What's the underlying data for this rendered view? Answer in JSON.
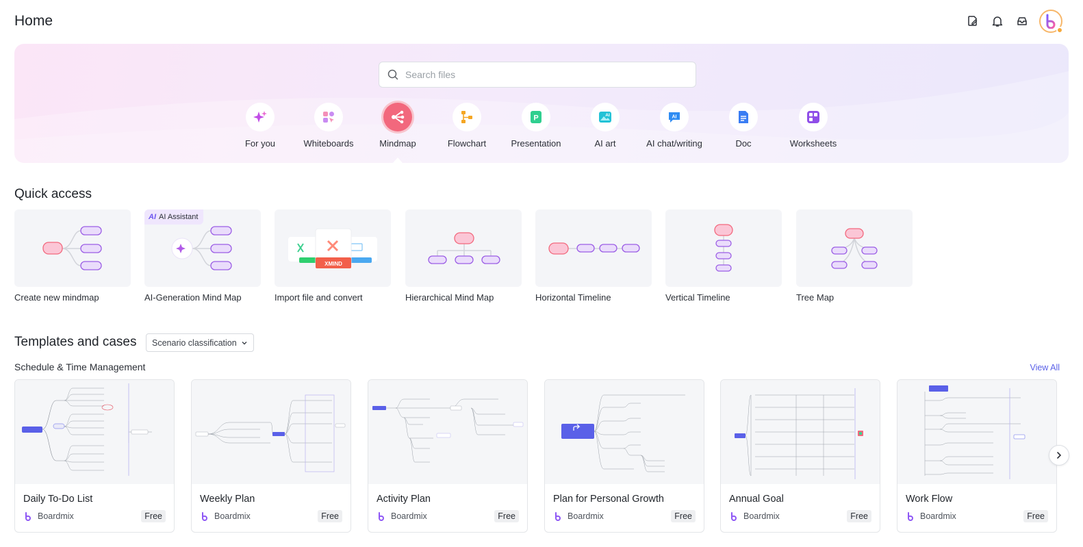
{
  "header": {
    "title": "Home",
    "icons": [
      "file-edit-icon",
      "bell-icon",
      "inbox-icon",
      "avatar"
    ]
  },
  "search": {
    "placeholder": "Search files"
  },
  "categories": [
    {
      "label": "For you",
      "icon": "sparkle-icon"
    },
    {
      "label": "Whiteboards",
      "icon": "whiteboard-icon"
    },
    {
      "label": "Mindmap",
      "icon": "mindmap-icon",
      "active": true
    },
    {
      "label": "Flowchart",
      "icon": "flowchart-icon"
    },
    {
      "label": "Presentation",
      "icon": "presentation-icon"
    },
    {
      "label": "AI art",
      "icon": "ai-art-icon"
    },
    {
      "label": "AI chat/writing",
      "icon": "ai-chat-icon"
    },
    {
      "label": "Doc",
      "icon": "doc-icon"
    },
    {
      "label": "Worksheets",
      "icon": "worksheet-icon"
    }
  ],
  "quick_access": {
    "title": "Quick access",
    "items": [
      {
        "label": "Create new mindmap"
      },
      {
        "label": "AI-Generation Mind Map",
        "badge": "AI Assistant"
      },
      {
        "label": "Import file and convert",
        "badge": "XMIND"
      },
      {
        "label": "Hierarchical Mind Map"
      },
      {
        "label": "Horizontal Timeline"
      },
      {
        "label": "Vertical Timeline"
      },
      {
        "label": "Tree Map"
      }
    ]
  },
  "templates": {
    "title": "Templates and cases",
    "filter": "Scenario classification",
    "subsection": "Schedule & Time Management",
    "view_all": "View All",
    "items": [
      {
        "name": "Daily To-Do List",
        "author": "Boardmix",
        "badge": "Free"
      },
      {
        "name": "Weekly Plan",
        "author": "Boardmix",
        "badge": "Free"
      },
      {
        "name": "Activity Plan",
        "author": "Boardmix",
        "badge": "Free"
      },
      {
        "name": "Plan for Personal Growth",
        "author": "Boardmix",
        "badge": "Free"
      },
      {
        "name": "Annual Goal",
        "author": "Boardmix",
        "badge": "Free"
      },
      {
        "name": "Work Flow",
        "author": "Boardmix",
        "badge": "Free"
      }
    ]
  },
  "colors": {
    "accent": "#f2687d",
    "link": "#5a60e8",
    "node_purple": "#9b5de5",
    "node_pink": "#f58ab1"
  }
}
